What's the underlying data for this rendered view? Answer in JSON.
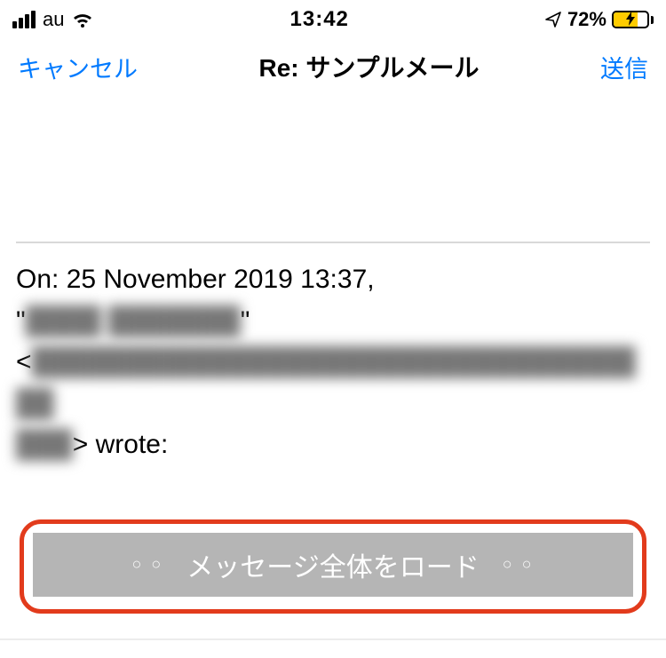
{
  "status": {
    "carrier": "au",
    "time": "13:42",
    "battery_pct": 72,
    "battery_text": "72%"
  },
  "nav": {
    "cancel": "キャンセル",
    "title": "Re: サンプルメール",
    "send": "送信"
  },
  "quoted": {
    "line1_prefix": "On: 25 November 2019 13:37,",
    "line2_open_quote": "\"",
    "line2_name_blur": "████ ███████",
    "line2_close_quote": "\"",
    "line3_open": "<",
    "line3_email_blur": "██████████████████████████████████",
    "line4_blur": "███",
    "line4_close": "> wrote:"
  },
  "load_button": {
    "label": "メッセージ全体をロード",
    "dots": "○ ○"
  }
}
